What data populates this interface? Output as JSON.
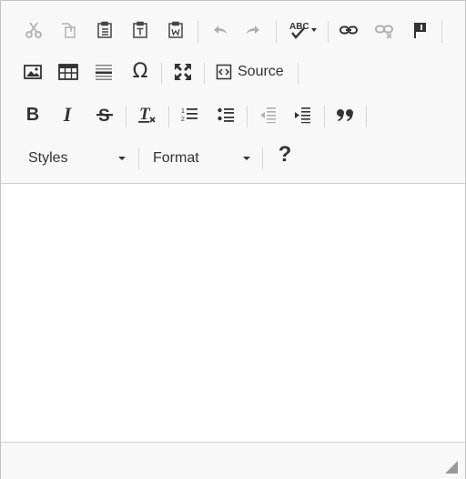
{
  "toolbar": {
    "source_label": "Source",
    "styles_label": "Styles",
    "format_label": "Format",
    "help_label": "?"
  },
  "icons": {
    "cut": "cut-icon",
    "copy": "copy-icon",
    "paste": "paste-icon",
    "paste_text": "paste-text-icon",
    "paste_word": "paste-word-icon",
    "undo": "undo-icon",
    "redo": "redo-icon",
    "spellcheck": "spellcheck-icon",
    "link": "link-icon",
    "unlink": "unlink-icon",
    "anchor": "anchor-flag-icon",
    "image": "image-icon",
    "table": "table-icon",
    "horizontal_rule": "horizontal-rule-icon",
    "special_char": "omega-icon",
    "maximize": "maximize-icon",
    "source": "source-icon",
    "bold": "bold-icon",
    "italic": "italic-icon",
    "strike": "strikethrough-icon",
    "remove_format": "remove-format-icon",
    "numbered_list": "numbered-list-icon",
    "bulleted_list": "bulleted-list-icon",
    "outdent": "outdent-icon",
    "indent": "indent-icon",
    "blockquote": "blockquote-icon"
  },
  "colors": {
    "toolbar_bg": "#f8f8f8",
    "icon_active": "#333333",
    "icon_disabled": "#b0b0b0",
    "border": "#c4c4c4"
  }
}
